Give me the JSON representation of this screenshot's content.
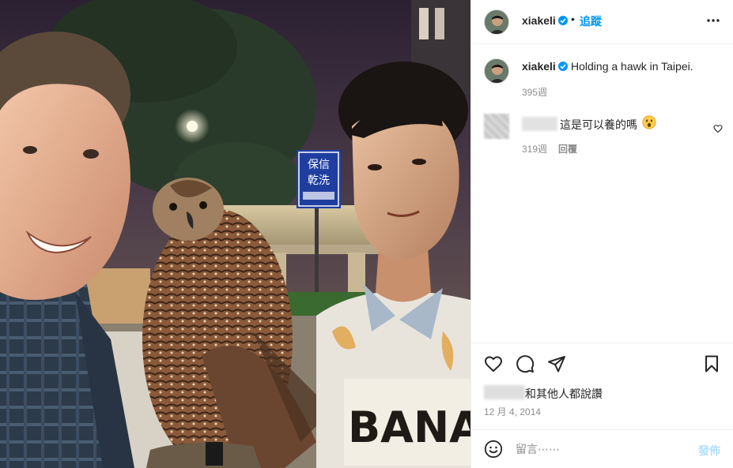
{
  "post": {
    "photo_alt": "",
    "photo_sign": {
      "line1": "保信",
      "line2": "乾洗"
    },
    "photo_shirt_text": "BANAN"
  },
  "header": {
    "username": "xiakeli",
    "separator": "•",
    "follow_label": "追蹤",
    "more_icon": "more-horizontal-icon",
    "verified_icon": "verified-badge-icon"
  },
  "caption": {
    "username": "xiakeli",
    "text": "Holding a hawk in Taipei.",
    "time": "395週"
  },
  "comment": {
    "text": "這是可以養的嗎",
    "emoji": "astonished-face-icon",
    "time": "319週",
    "reply_label": "回覆",
    "like_icon": "heart-small-icon"
  },
  "actions": {
    "like_icon": "heart-icon",
    "comment_icon": "comment-icon",
    "share_icon": "send-icon",
    "save_icon": "bookmark-icon"
  },
  "likes": {
    "text": "和其他人都說讚"
  },
  "date": "12 月 4, 2014",
  "comment_box": {
    "emoji_icon": "smile-icon",
    "placeholder": "留言⋯⋯",
    "post_label": "發佈"
  },
  "colors": {
    "accent": "#0095f6",
    "post_disabled": "#b2dffc",
    "muted": "#8e8e8e"
  }
}
